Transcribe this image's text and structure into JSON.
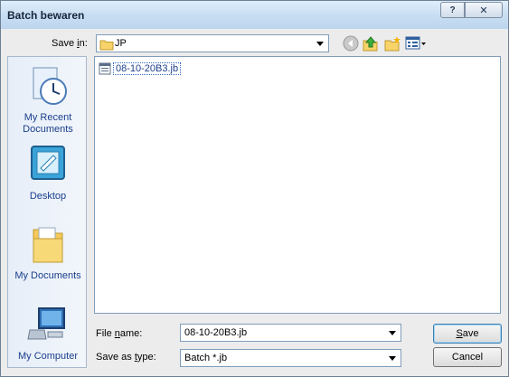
{
  "dialog": {
    "title": "Batch bewaren",
    "help_label": "?",
    "close_label": "✕"
  },
  "save_in": {
    "label_pre": "Save ",
    "label_u": "i",
    "label_post": "n:",
    "value": "JP"
  },
  "toolbar": {
    "icons": [
      "back-icon",
      "up-folder-icon",
      "new-folder-icon",
      "views-menu-icon"
    ]
  },
  "places": {
    "items": [
      {
        "name": "recent-documents",
        "label_line1": "My Recent",
        "label_line2": "Documents"
      },
      {
        "name": "desktop",
        "label_line1": "Desktop",
        "label_line2": ""
      },
      {
        "name": "my-documents",
        "label_line1": "My Documents",
        "label_line2": ""
      },
      {
        "name": "my-computer",
        "label_line1": "My Computer",
        "label_line2": ""
      }
    ]
  },
  "files": [
    {
      "name": "08-10-20B3.jb"
    }
  ],
  "file_name": {
    "label_pre": "File ",
    "label_u": "n",
    "label_post": "ame:",
    "value": "08-10-20B3.jb"
  },
  "save_as_type": {
    "label_pre": "Save as ",
    "label_u": "t",
    "label_post": "ype:",
    "value": "Batch *.jb"
  },
  "buttons": {
    "save_u": "S",
    "save_rest": "ave",
    "cancel": "Cancel"
  },
  "colors": {
    "title_gradient_top": "#dfeefb",
    "accent": "#316ac5",
    "place_text": "#1a3e8c"
  }
}
